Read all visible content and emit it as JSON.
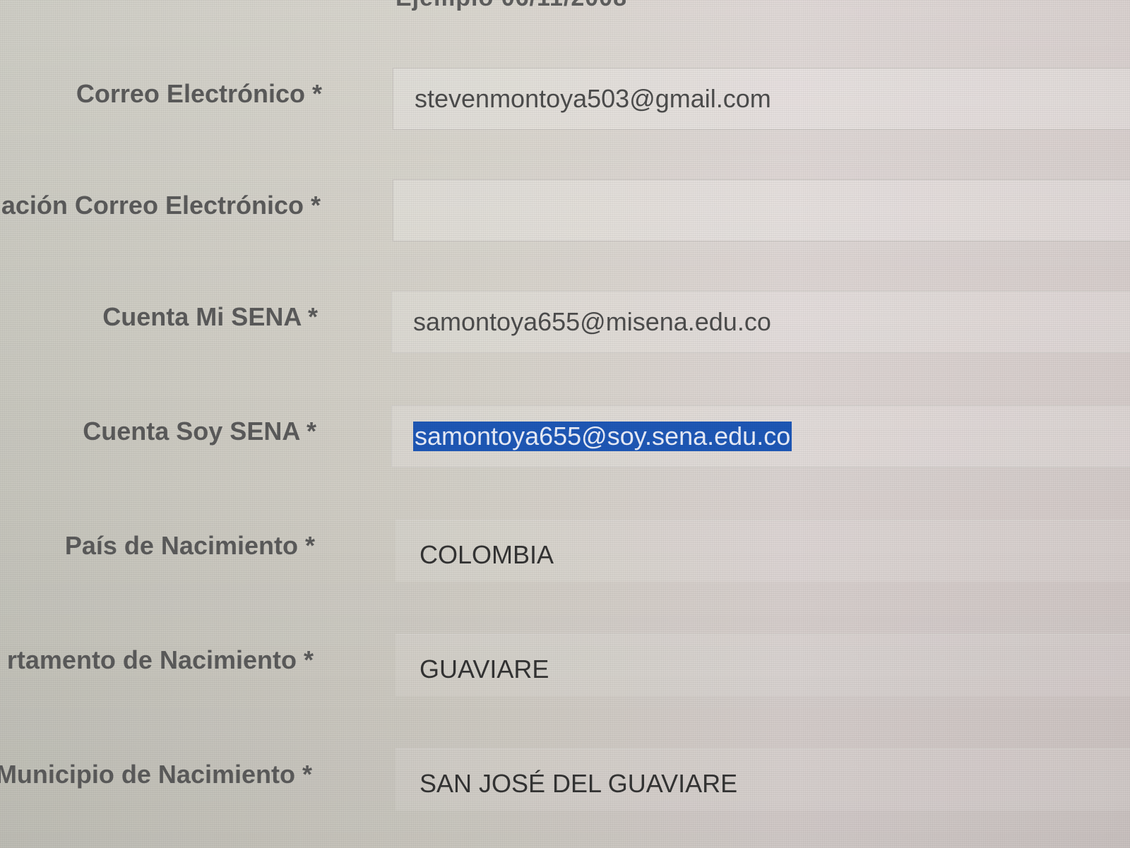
{
  "header": {
    "partial_text": "Ejemplo 06/11/2008"
  },
  "form": {
    "fields": [
      {
        "label": "Correo Electrónico *",
        "value": "stevenmontoya503@gmail.com"
      },
      {
        "label": "ación Correo Electrónico *",
        "value": ""
      },
      {
        "label": "Cuenta Mi SENA *",
        "value": "samontoya655@misena.edu.co"
      },
      {
        "label": "Cuenta Soy SENA *",
        "value": "samontoya655@soy.sena.edu.co"
      },
      {
        "label": "País de Nacimiento *",
        "value": "COLOMBIA"
      },
      {
        "label": "rtamento de Nacimiento *",
        "value": "GUAVIARE"
      },
      {
        "label": "Municipio de Nacimiento *",
        "value": "SAN JOSÉ DEL GUAVIARE"
      }
    ]
  },
  "colors": {
    "selection": "#1e57b5",
    "label_text": "#5a5a5a",
    "value_text": "#4c4c4c"
  }
}
